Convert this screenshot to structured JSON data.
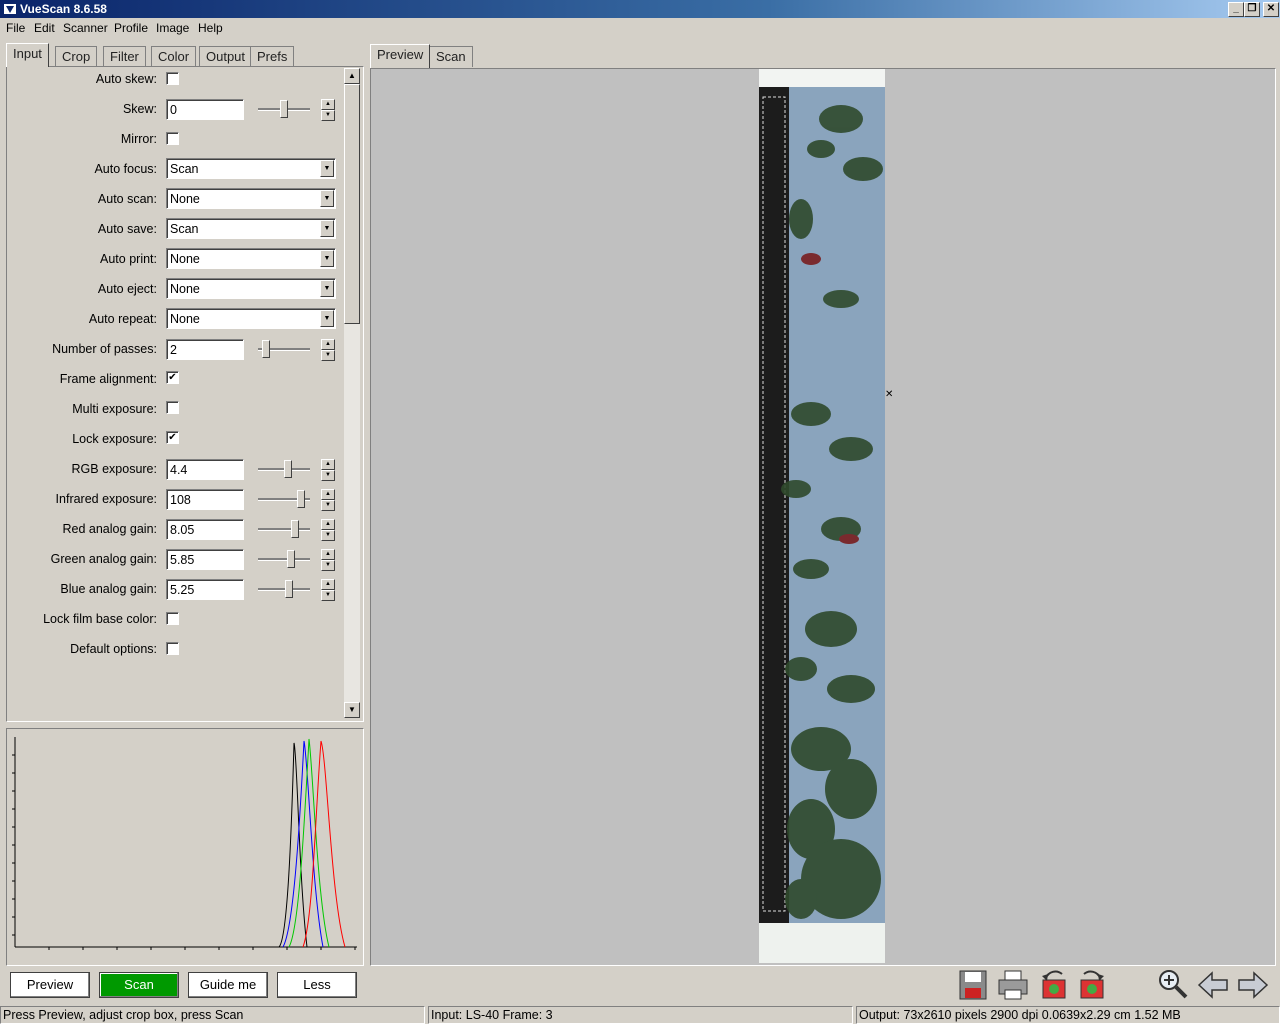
{
  "window": {
    "title": "VueScan 8.6.58"
  },
  "menu": [
    "File",
    "Edit",
    "Scanner",
    "Profile",
    "Image",
    "Help"
  ],
  "left_tabs": [
    "Input",
    "Crop",
    "Filter",
    "Color",
    "Output",
    "Prefs"
  ],
  "right_tabs": [
    "Preview",
    "Scan"
  ],
  "options": {
    "auto_skew": {
      "label": "Auto skew:",
      "checked": false
    },
    "skew": {
      "label": "Skew:",
      "value": "0",
      "slider": 0.5
    },
    "mirror": {
      "label": "Mirror:",
      "checked": false
    },
    "auto_focus": {
      "label": "Auto focus:",
      "value": "Scan"
    },
    "auto_scan": {
      "label": "Auto scan:",
      "value": "None"
    },
    "auto_save": {
      "label": "Auto save:",
      "value": "Scan"
    },
    "auto_print": {
      "label": "Auto print:",
      "value": "None"
    },
    "auto_eject": {
      "label": "Auto eject:",
      "value": "None"
    },
    "auto_repeat": {
      "label": "Auto repeat:",
      "value": "None"
    },
    "number_of_passes": {
      "label": "Number of passes:",
      "value": "2",
      "slider": 0.1
    },
    "frame_alignment": {
      "label": "Frame alignment:",
      "checked": true
    },
    "multi_exposure": {
      "label": "Multi exposure:",
      "checked": false
    },
    "lock_exposure": {
      "label": "Lock exposure:",
      "checked": true
    },
    "rgb_exposure": {
      "label": "RGB exposure:",
      "value": "4.4",
      "slider": 0.6
    },
    "infrared_exposure": {
      "label": "Infrared exposure:",
      "value": "108",
      "slider": 0.88
    },
    "red_analog_gain": {
      "label": "Red analog gain:",
      "value": "8.05",
      "slider": 0.75
    },
    "green_analog_gain": {
      "label": "Green analog gain:",
      "value": "5.85",
      "slider": 0.65
    },
    "blue_analog_gain": {
      "label": "Blue analog gain:",
      "value": "5.25",
      "slider": 0.62
    },
    "lock_film_base_color": {
      "label": "Lock film base color:",
      "checked": false
    },
    "default_options": {
      "label": "Default options:",
      "checked": false
    }
  },
  "buttons": {
    "preview": "Preview",
    "scan": "Scan",
    "guide_me": "Guide me",
    "less": "Less"
  },
  "toolbar_icons": [
    "save-icon",
    "print-icon",
    "rotate-left-icon",
    "rotate-right-icon",
    "zoom-in-icon",
    "previous-arrow-icon",
    "next-arrow-icon"
  ],
  "status": {
    "left": "Press Preview, adjust crop box, press Scan",
    "middle": "Input: LS-40 Frame: 3",
    "right": "Output: 73x2610 pixels 2900 dpi 0.0639x2.29 cm 1.52 MB"
  },
  "colors": {
    "scan_button": "#009900",
    "title_bar": "#0a246a",
    "check_mark": "#000000"
  }
}
